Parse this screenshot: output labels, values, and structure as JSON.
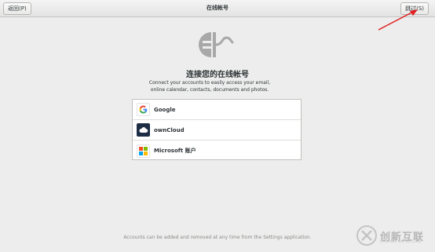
{
  "header": {
    "back_label": "返回(P)",
    "title": "在线帐号",
    "skip_label": "跳过(S)"
  },
  "main": {
    "title": "连接您的在线帐号",
    "desc_line1": "Connect your accounts to easily access your email,",
    "desc_line2": "online calendar, contacts, documents and photos."
  },
  "providers": [
    {
      "label": "Google",
      "icon": "google-icon"
    },
    {
      "label": "ownCloud",
      "icon": "owncloud-icon"
    },
    {
      "label": "Microsoft 账户",
      "icon": "microsoft-icon"
    }
  ],
  "footer": {
    "text": "Accounts can be added and removed at any time from the Settings application."
  },
  "watermark": {
    "brand": "创新互联",
    "sub": "CHUANG XIN HU LIAN"
  },
  "annotation": {
    "arrow_color": "#e02020"
  }
}
